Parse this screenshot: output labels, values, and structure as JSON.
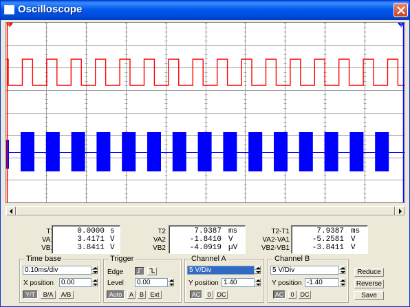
{
  "window": {
    "title": "Oscilloscope",
    "icon": "window-icon",
    "close": "close-icon"
  },
  "screen": {
    "background": "#FFFFFF",
    "grid_color": "#A0A0A0",
    "trace_a_color": "#FF0000",
    "trace_b_color": "#0000FF",
    "cursor1_label": "1",
    "cursor2_label": "2",
    "channel_a_x_position": 0.0,
    "channel_b_y_position": -1.4,
    "trace_a": "square-wave",
    "trace_b": "burst"
  },
  "scrollbar": {
    "left_icon": "arrow-left-icon",
    "right_icon": "arrow-right-icon"
  },
  "readouts": {
    "t1": {
      "time_label": "T1",
      "time_value": "0.0000",
      "time_unit": "s",
      "va_label": "VA1",
      "va_value": "3.4171",
      "va_unit": "V",
      "vb_label": "VB1",
      "vb_value": "3.8411",
      "vb_unit": "V"
    },
    "t2": {
      "time_label": "T2",
      "time_value": "7.9387",
      "time_unit": "ms",
      "va_label": "VA2",
      "va_value": "-1.8410",
      "va_unit": "V",
      "vb_label": "VB2",
      "vb_value": "-4.0919",
      "vb_unit": "µV"
    },
    "delta": {
      "time_label": "T2-T1",
      "time_value": "7.9387",
      "time_unit": "ms",
      "va_label": "VA2-VA1",
      "va_value": "-5.2581",
      "va_unit": "V",
      "vb_label": "VB2-VB1",
      "vb_value": "-3.8411",
      "vb_unit": "V"
    }
  },
  "time_base": {
    "title": "Time base",
    "scale": "0.10ms/div",
    "x_position_label": "X position",
    "x_position": "0.00",
    "modes": [
      "Y/T",
      "B/A",
      "A/B"
    ],
    "active_mode": "Y/T"
  },
  "trigger": {
    "title": "Trigger",
    "edge_label": "Edge",
    "level_label": "Level",
    "level": "0.00",
    "sources": [
      "Auto",
      "A",
      "B",
      "Ext"
    ]
  },
  "channel_a": {
    "title": "Channel A",
    "scale": "5 V/Div",
    "y_position_label": "Y position",
    "y_position": "1.40",
    "coupling": [
      "AC",
      "0",
      "DC"
    ]
  },
  "channel_b": {
    "title": "Channel B",
    "scale": "5 V/Div",
    "y_position_label": "Y position",
    "y_position": "-1.40",
    "coupling": [
      "AC",
      "0",
      "DC"
    ]
  },
  "actions": {
    "reduce": "Reduce",
    "reverse": "Reverse",
    "save": "Save"
  }
}
